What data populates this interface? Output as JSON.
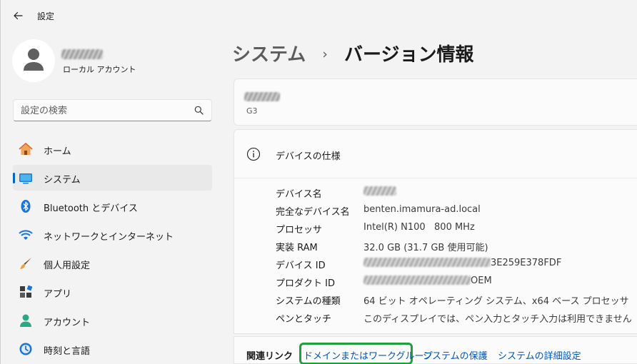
{
  "window": {
    "title": "設定",
    "back_icon": "back-arrow-icon"
  },
  "profile": {
    "account_type": "ローカル アカウント",
    "avatar_icon": "person-icon"
  },
  "search": {
    "placeholder": "設定の検索",
    "value": "",
    "icon": "search-icon"
  },
  "nav": {
    "items": [
      {
        "label": "ホーム",
        "icon": "home-icon",
        "active": false
      },
      {
        "label": "システム",
        "icon": "system-display-icon",
        "active": true
      },
      {
        "label": "Bluetooth とデバイス",
        "icon": "bluetooth-icon",
        "active": false
      },
      {
        "label": "ネットワークとインターネット",
        "icon": "wifi-icon",
        "active": false
      },
      {
        "label": "個人用設定",
        "icon": "brush-icon",
        "active": false
      },
      {
        "label": "アプリ",
        "icon": "apps-icon",
        "active": false
      },
      {
        "label": "アカウント",
        "icon": "account-icon",
        "active": false
      },
      {
        "label": "時刻と言語",
        "icon": "time-language-icon",
        "active": false
      }
    ]
  },
  "breadcrumb": {
    "parent": "システム",
    "separator": "›",
    "current": "バージョン情報"
  },
  "device": {
    "model": "G3"
  },
  "specs": {
    "title": "デバイスの仕様",
    "icon": "info-icon",
    "rows": [
      {
        "label": "デバイス名",
        "value": ""
      },
      {
        "label": "完全なデバイス名",
        "value": "benten.imamura-ad.local"
      },
      {
        "label": "プロセッサ",
        "value": "Intel(R) N100   800 MHz"
      },
      {
        "label": "実装 RAM",
        "value": "32.0 GB (31.7 GB 使用可能)"
      },
      {
        "label": "デバイス ID",
        "value": "3E259E378FDF"
      },
      {
        "label": "プロダクト ID",
        "value": "OEM"
      },
      {
        "label": "システムの種類",
        "value": "64 ビット オペレーティング システム、x64 ベース プロセッサ"
      },
      {
        "label": "ペンとタッチ",
        "value": "このディスプレイでは、ペン入力とタッチ入力は利用できません"
      }
    ]
  },
  "related_links": {
    "label": "関連リンク",
    "links": [
      "ドメインまたはワークグループ",
      "システムの保護",
      "システムの詳細設定"
    ],
    "highlight_color": "#1fa13a"
  },
  "colors": {
    "accent": "#0067c0",
    "link": "#0055b3",
    "background": "#f3f3f3",
    "card": "#fbfbfb"
  }
}
